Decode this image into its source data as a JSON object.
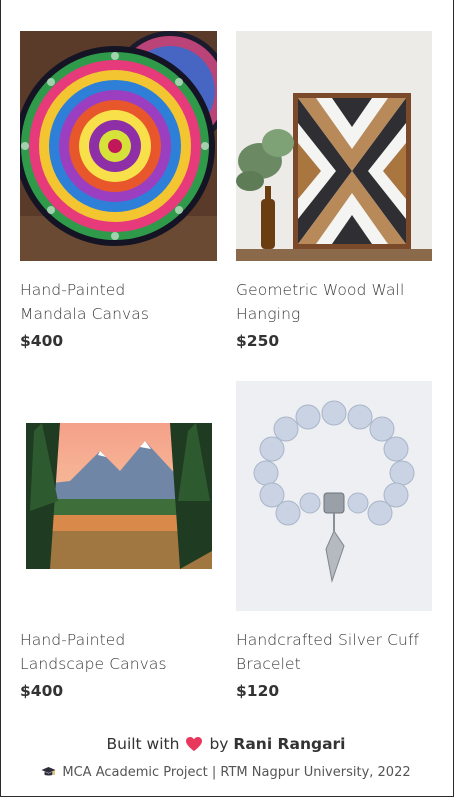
{
  "products": [
    {
      "title_line1": "Hand-Painted",
      "title_line2": "Mandala Canvas",
      "price": "$400",
      "image_icon": "mandala-image"
    },
    {
      "title_line1": "Geometric Wood Wall",
      "title_line2": "Hanging",
      "price": "$250",
      "image_icon": "wood-wall-art-image"
    },
    {
      "title_line1": "Hand-Painted",
      "title_line2": "Landscape Canvas",
      "price": "$400",
      "image_icon": "landscape-image"
    },
    {
      "title_line1": "Handcrafted Silver Cuff",
      "title_line2": "Bracelet",
      "price": "$120",
      "image_icon": "bracelet-image"
    }
  ],
  "footer": {
    "built_with": "Built with",
    "by": "by",
    "author": "Rani Rangari",
    "project": "MCA Academic Project | RTM Nagpur University, 2022",
    "heart_color": "#e8365d"
  }
}
